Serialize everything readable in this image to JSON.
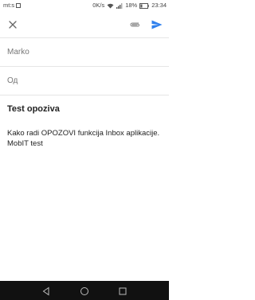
{
  "status_bar": {
    "carrier": "mt:s",
    "network_speed": "0K/s",
    "battery_percent": "18%",
    "time": "23:34"
  },
  "toolbar": {
    "close_icon": "close-icon",
    "attach_icon": "paperclip-icon",
    "send_icon": "send-icon",
    "send_color": "#2f80ed"
  },
  "compose": {
    "to_value": "Marko",
    "from_label": "Од",
    "subject": "Test opoziva",
    "body": "Kako radi OPOZOVI funkcija Inbox aplikacije. MobIT test"
  },
  "nav_bar": {
    "back_icon": "back-icon",
    "home_icon": "home-icon",
    "recent_icon": "recent-apps-icon"
  }
}
